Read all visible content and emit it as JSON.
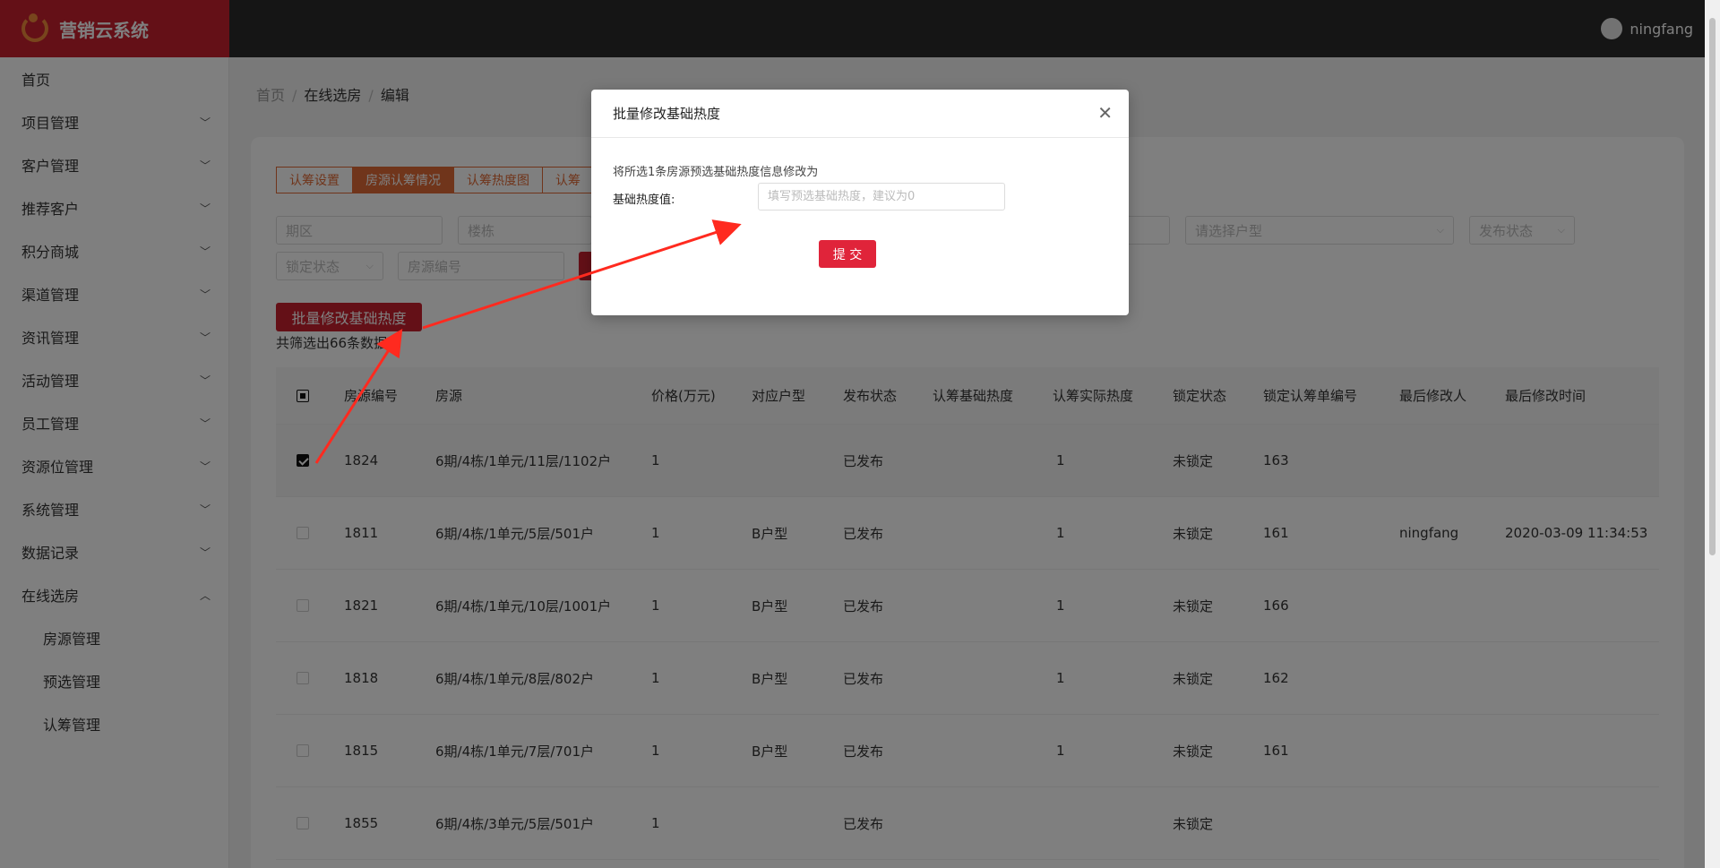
{
  "app": {
    "title": "营销云系统",
    "user": "ningfang"
  },
  "sidebar": {
    "items": [
      {
        "label": "首页",
        "expandable": false
      },
      {
        "label": "项目管理",
        "expandable": true
      },
      {
        "label": "客户管理",
        "expandable": true
      },
      {
        "label": "推荐客户",
        "expandable": true
      },
      {
        "label": "积分商城",
        "expandable": true
      },
      {
        "label": "渠道管理",
        "expandable": true
      },
      {
        "label": "资讯管理",
        "expandable": true
      },
      {
        "label": "活动管理",
        "expandable": true
      },
      {
        "label": "员工管理",
        "expandable": true
      },
      {
        "label": "资源位管理",
        "expandable": true
      },
      {
        "label": "系统管理",
        "expandable": true
      },
      {
        "label": "数据记录",
        "expandable": true
      },
      {
        "label": "在线选房",
        "expandable": true,
        "expanded": true
      }
    ],
    "sub_items": [
      "房源管理",
      "预选管理",
      "认筹管理"
    ]
  },
  "breadcrumb": {
    "home": "首页",
    "section": "在线选房",
    "page": "编辑"
  },
  "tabs": [
    "认筹设置",
    "房源认筹情况",
    "认筹热度图",
    "认筹"
  ],
  "filters": {
    "phase": "期区",
    "building": "楼栋",
    "house_type": "请选择户型",
    "publish_status": "发布状态",
    "lock_status": "锁定状态",
    "house_no": "房源编号"
  },
  "batch_button": "批量修改基础热度",
  "count_text": "共筛选出66条数据",
  "table": {
    "headers": [
      "房源编号",
      "房源",
      "价格(万元)",
      "对应户型",
      "发布状态",
      "认筹基础热度",
      "认筹实际热度",
      "锁定状态",
      "锁定认筹单编号",
      "最后修改人",
      "最后修改时间"
    ],
    "rows": [
      {
        "checked": true,
        "no": "1824",
        "house": "6期/4栋/1单元/11层/1102户",
        "price": "1",
        "type": "",
        "status": "已发布",
        "base": "",
        "actual": "1",
        "lock": "未锁定",
        "order": "163",
        "modifier": "",
        "time": ""
      },
      {
        "checked": false,
        "no": "1811",
        "house": "6期/4栋/1单元/5层/501户",
        "price": "1",
        "type": "B户型",
        "status": "已发布",
        "base": "",
        "actual": "1",
        "lock": "未锁定",
        "order": "161",
        "modifier": "ningfang",
        "time": "2020-03-09 11:34:53"
      },
      {
        "checked": false,
        "no": "1821",
        "house": "6期/4栋/1单元/10层/1001户",
        "price": "1",
        "type": "B户型",
        "status": "已发布",
        "base": "",
        "actual": "1",
        "lock": "未锁定",
        "order": "166",
        "modifier": "",
        "time": ""
      },
      {
        "checked": false,
        "no": "1818",
        "house": "6期/4栋/1单元/8层/802户",
        "price": "1",
        "type": "B户型",
        "status": "已发布",
        "base": "",
        "actual": "1",
        "lock": "未锁定",
        "order": "162",
        "modifier": "",
        "time": ""
      },
      {
        "checked": false,
        "no": "1815",
        "house": "6期/4栋/1单元/7层/701户",
        "price": "1",
        "type": "B户型",
        "status": "已发布",
        "base": "",
        "actual": "1",
        "lock": "未锁定",
        "order": "161",
        "modifier": "",
        "time": ""
      },
      {
        "checked": false,
        "no": "1855",
        "house": "6期/4栋/3单元/5层/501户",
        "price": "1",
        "type": "",
        "status": "已发布",
        "base": "",
        "actual": "",
        "lock": "未锁定",
        "order": "",
        "modifier": "",
        "time": ""
      }
    ]
  },
  "modal": {
    "title": "批量修改基础热度",
    "description": "将所选1条房源预选基础热度信息修改为",
    "field_label": "基础热度值:",
    "field_value": "",
    "field_placeholder": "填写预选基础热度，建议为0",
    "submit": "提 交"
  },
  "colors": {
    "brand": "#c9202f",
    "accent": "#e06a36",
    "annotation": "#ff2a1f"
  }
}
